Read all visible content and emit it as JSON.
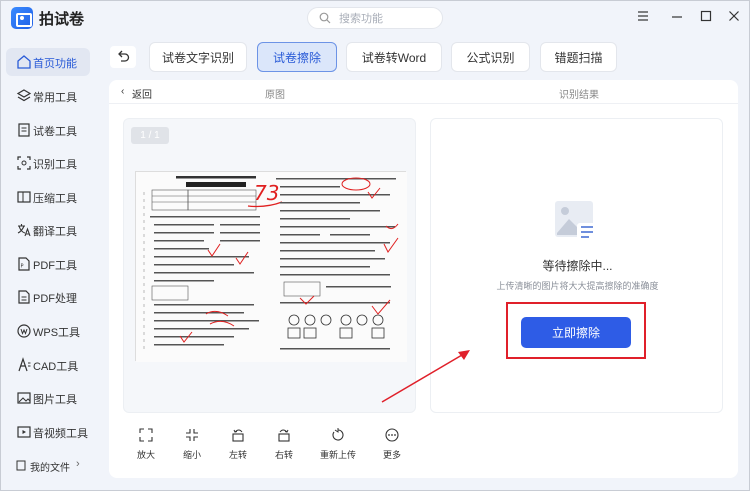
{
  "app": {
    "title": "拍试卷"
  },
  "search": {
    "placeholder": "搜索功能"
  },
  "window_controls": [
    "menu-icon",
    "minimize-icon",
    "maximize-icon",
    "close-icon"
  ],
  "sidebar": {
    "items": [
      {
        "label": "首页功能",
        "icon": "home-icon",
        "active": true
      },
      {
        "label": "常用工具",
        "icon": "layers-icon"
      },
      {
        "label": "试卷工具",
        "icon": "document-icon"
      },
      {
        "label": "识别工具",
        "icon": "scan-icon"
      },
      {
        "label": "压缩工具",
        "icon": "compress-icon"
      },
      {
        "label": "翻译工具",
        "icon": "translate-icon"
      },
      {
        "label": "PDF工具",
        "icon": "pdf-icon"
      },
      {
        "label": "PDF处理",
        "icon": "pdf-process-icon"
      },
      {
        "label": "WPS工具",
        "icon": "wps-icon"
      },
      {
        "label": "CAD工具",
        "icon": "cad-icon"
      },
      {
        "label": "图片工具",
        "icon": "image-icon"
      },
      {
        "label": "音视频工具",
        "icon": "video-icon"
      }
    ],
    "my_files": "我的文件"
  },
  "tabs": [
    {
      "label": "试卷文字识别"
    },
    {
      "label": "试卷擦除",
      "active": true
    },
    {
      "label": "试卷转Word"
    },
    {
      "label": "公式识别"
    },
    {
      "label": "错题扫描"
    }
  ],
  "subheader": {
    "back": "返回",
    "original": "原图",
    "result": "识别结果"
  },
  "preview": {
    "page_indicator": "1 / 1",
    "score": "73"
  },
  "result": {
    "status": "等待擦除中...",
    "hint": "上传清晰的图片将大大提高擦除的准确度",
    "action_button": "立即擦除",
    "accent_color": "#2e5ce6",
    "highlight_color": "#e0202a"
  },
  "toolbar": [
    {
      "label": "放大",
      "icon": "zoom-in-icon"
    },
    {
      "label": "缩小",
      "icon": "zoom-out-icon"
    },
    {
      "label": "左转",
      "icon": "rotate-left-icon"
    },
    {
      "label": "右转",
      "icon": "rotate-right-icon"
    },
    {
      "label": "重新上传",
      "icon": "reupload-icon"
    },
    {
      "label": "更多",
      "icon": "more-icon"
    }
  ]
}
